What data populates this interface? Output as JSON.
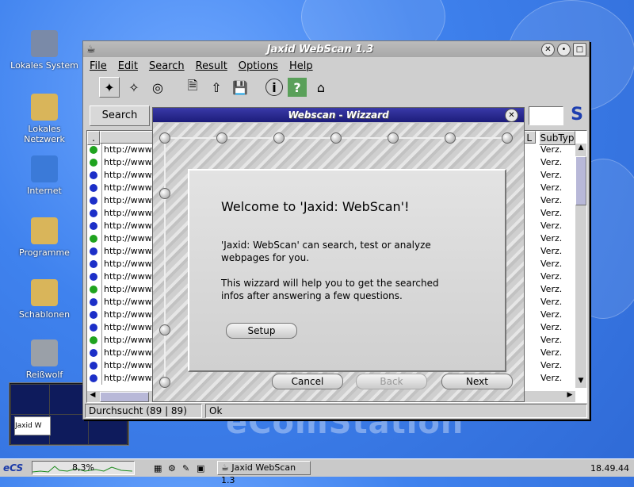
{
  "desktop": {
    "icons": [
      {
        "label": "Lokales System",
        "icon": "computer-icon",
        "color": "#7a8aa8"
      },
      {
        "label": "Lokales Netzwerk",
        "icon": "network-folder-icon",
        "color": "#d9b55a"
      },
      {
        "label": "Internet",
        "icon": "globe-folder-icon",
        "color": "#3b7ad8"
      },
      {
        "label": "Programme",
        "icon": "programs-folder-icon",
        "color": "#d9b55a"
      },
      {
        "label": "Schablonen",
        "icon": "templates-folder-icon",
        "color": "#d9b55a"
      },
      {
        "label": "Reißwolf",
        "icon": "shredder-icon",
        "color": "#9aa0a8"
      }
    ],
    "watermark": "eComStation"
  },
  "window": {
    "title": "Jaxid WebScan 1.3",
    "menu": [
      "File",
      "Edit",
      "Search",
      "Result",
      "Options",
      "Help"
    ],
    "search_button": "Search",
    "logo": "S",
    "columns": {
      "first": ".",
      "second": "L",
      "subtyp": "SubTyp"
    },
    "rows": [
      {
        "url": "http://www.ja",
        "sub": "Verz.",
        "status": "green"
      },
      {
        "url": "http://www.ja",
        "sub": "Verz.",
        "status": "green"
      },
      {
        "url": "http://www.ja",
        "sub": "Verz.",
        "status": "blue"
      },
      {
        "url": "http://www.ja",
        "sub": "Verz.",
        "status": "blue"
      },
      {
        "url": "http://www.ja",
        "sub": "Verz.",
        "status": "blue"
      },
      {
        "url": "http://www.ja",
        "sub": "Verz.",
        "status": "blue"
      },
      {
        "url": "http://www.ja",
        "sub": "Verz.",
        "status": "blue"
      },
      {
        "url": "http://www.ja",
        "sub": "Verz.",
        "status": "green"
      },
      {
        "url": "http://www.ja",
        "sub": "Verz.",
        "status": "blue"
      },
      {
        "url": "http://www.ja",
        "sub": "Verz.",
        "status": "blue"
      },
      {
        "url": "http://www.ja",
        "sub": "Verz.",
        "status": "blue"
      },
      {
        "url": "http://www.ja",
        "sub": "Verz.",
        "status": "green"
      },
      {
        "url": "http://www.ja",
        "sub": "Verz.",
        "status": "blue"
      },
      {
        "url": "http://www.ja",
        "sub": "Verz.",
        "status": "blue"
      },
      {
        "url": "http://www.ja",
        "sub": "Verz.",
        "status": "blue"
      },
      {
        "url": "http://www.ja",
        "sub": "Verz.",
        "status": "green"
      },
      {
        "url": "http://www.ja",
        "sub": "Verz.",
        "status": "blue"
      },
      {
        "url": "http://www.ja",
        "sub": "Verz.",
        "status": "blue"
      },
      {
        "url": "http://www.ja",
        "sub": "Verz.",
        "status": "blue"
      }
    ],
    "status_left": "Durchsucht (89 | 89)",
    "status_right": "Ok"
  },
  "wizard": {
    "title": "Webscan - Wizzard",
    "welcome": "Welcome to 'Jaxid: WebScan'!",
    "p1_line1": "'Jaxid: WebScan' can search, test or analyze",
    "p1_line2": "webpages for you.",
    "p2_line1": "This wizzard will help you to get the searched",
    "p2_line2": "infos after answering a few questions.",
    "setup": "Setup",
    "cancel": "Cancel",
    "back": "Back",
    "next": "Next"
  },
  "pager": {
    "thumb_label": "Jaxid W"
  },
  "taskbar": {
    "logo": "eCS",
    "cpu": "8,3%",
    "task": "Jaxid WebScan 1.3",
    "clock": "18.49.44"
  },
  "colors": {
    "status_green": "#1fa31f",
    "status_blue": "#1c2fc8"
  }
}
